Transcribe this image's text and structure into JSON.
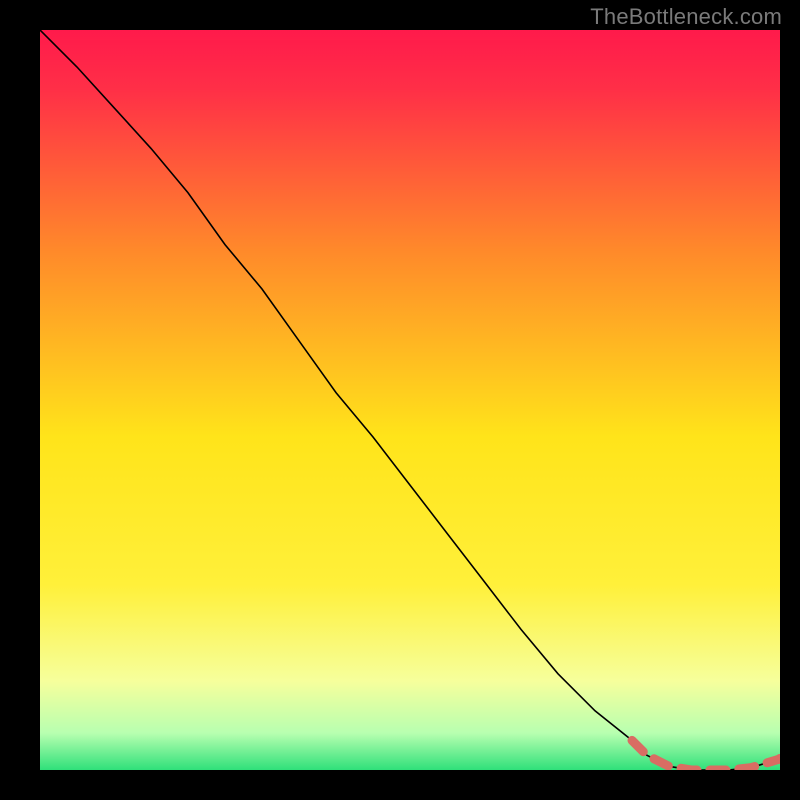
{
  "watermark": "TheBottleneck.com",
  "chart_data": {
    "type": "line",
    "title": "",
    "xlabel": "",
    "ylabel": "",
    "xlim": [
      0,
      100
    ],
    "ylim": [
      0,
      100
    ],
    "grid": false,
    "legend": false,
    "gradient": {
      "top": "#ff1a4b",
      "upper_mid": "#ff8a2a",
      "mid": "#ffe41a",
      "low": "#f6ff9c",
      "bottom": "#2fe07a"
    },
    "series": [
      {
        "name": "main-curve",
        "style": "solid-thin-black",
        "x": [
          0,
          5,
          10,
          15,
          20,
          25,
          30,
          35,
          40,
          45,
          50,
          55,
          60,
          65,
          70,
          75,
          80,
          82,
          85,
          88,
          90,
          93,
          96,
          100
        ],
        "y": [
          100,
          95,
          89.5,
          84,
          78,
          71,
          65,
          58,
          51,
          45,
          38.5,
          32,
          25.5,
          19,
          13,
          8,
          4,
          2,
          0.5,
          0,
          0,
          0,
          0.3,
          1.5
        ]
      },
      {
        "name": "highlight-segment",
        "style": "dashed-thick-salmon",
        "x": [
          80,
          82,
          85,
          88,
          90,
          93,
          96,
          100
        ],
        "y": [
          4,
          2,
          0.5,
          0,
          0,
          0,
          0.3,
          1.5
        ]
      }
    ],
    "highlight_end_marker": {
      "x": 100,
      "y": 1.5,
      "color": "#d96d63"
    }
  }
}
